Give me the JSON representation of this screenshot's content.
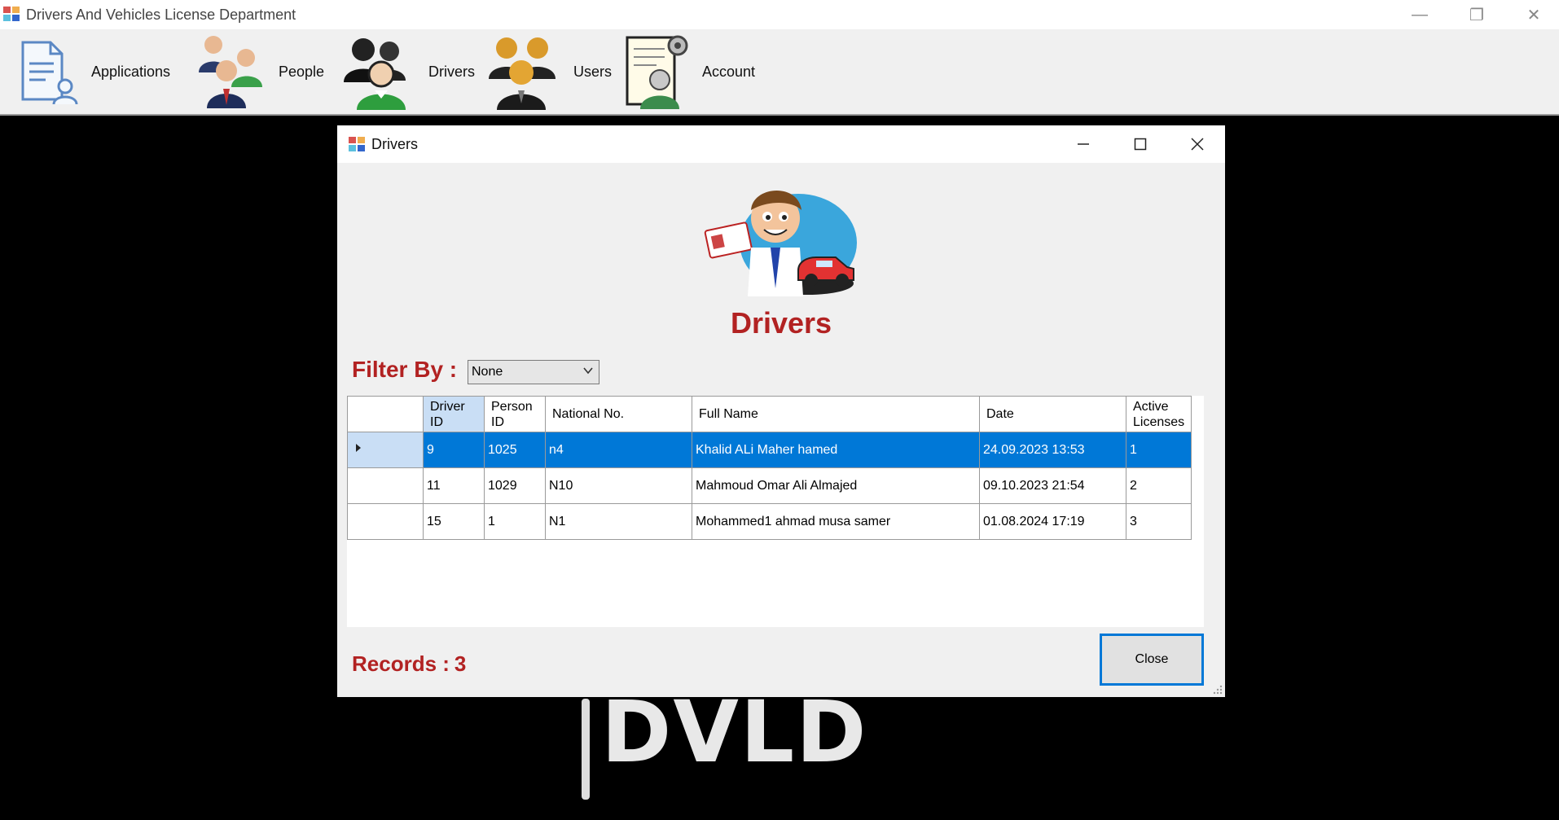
{
  "app": {
    "title": "Drivers And Vehicles License Department",
    "window_buttons": [
      "minimize",
      "restore",
      "close"
    ]
  },
  "menu": {
    "items": [
      {
        "label": "Applications",
        "icon": "applications-document-icon"
      },
      {
        "label": "People",
        "icon": "people-group-icon"
      },
      {
        "label": "Drivers",
        "icon": "drivers-people-icon"
      },
      {
        "label": "Users",
        "icon": "users-group-icon"
      },
      {
        "label": "Account",
        "icon": "account-settings-icon"
      }
    ]
  },
  "background": {
    "logo_text": "DVLD"
  },
  "dialog": {
    "title": "Drivers",
    "heading": "Drivers",
    "filter": {
      "label": "Filter By :",
      "selected": "None"
    },
    "grid": {
      "columns": [
        "Driver ID",
        "Person ID",
        "National No.",
        "Full Name",
        "Date",
        "Active Licenses"
      ],
      "rows": [
        [
          "9",
          "1025",
          "n4",
          "Khalid ALi Maher hamed",
          "24.09.2023 13:53",
          "1"
        ],
        [
          "11",
          "1029",
          "N10",
          "Mahmoud Omar Ali Almajed",
          "09.10.2023 21:54",
          "2"
        ],
        [
          "15",
          "1",
          "N1",
          "Mohammed1 ahmad musa samer",
          "01.08.2024 17:19",
          "3"
        ]
      ],
      "selected_row": 0
    },
    "records": {
      "label": "Records :",
      "count": "3"
    },
    "close_label": "Close"
  },
  "colors": {
    "accent": "#0078d7",
    "heading": "#b22222",
    "selected_row": "#0078d7"
  }
}
